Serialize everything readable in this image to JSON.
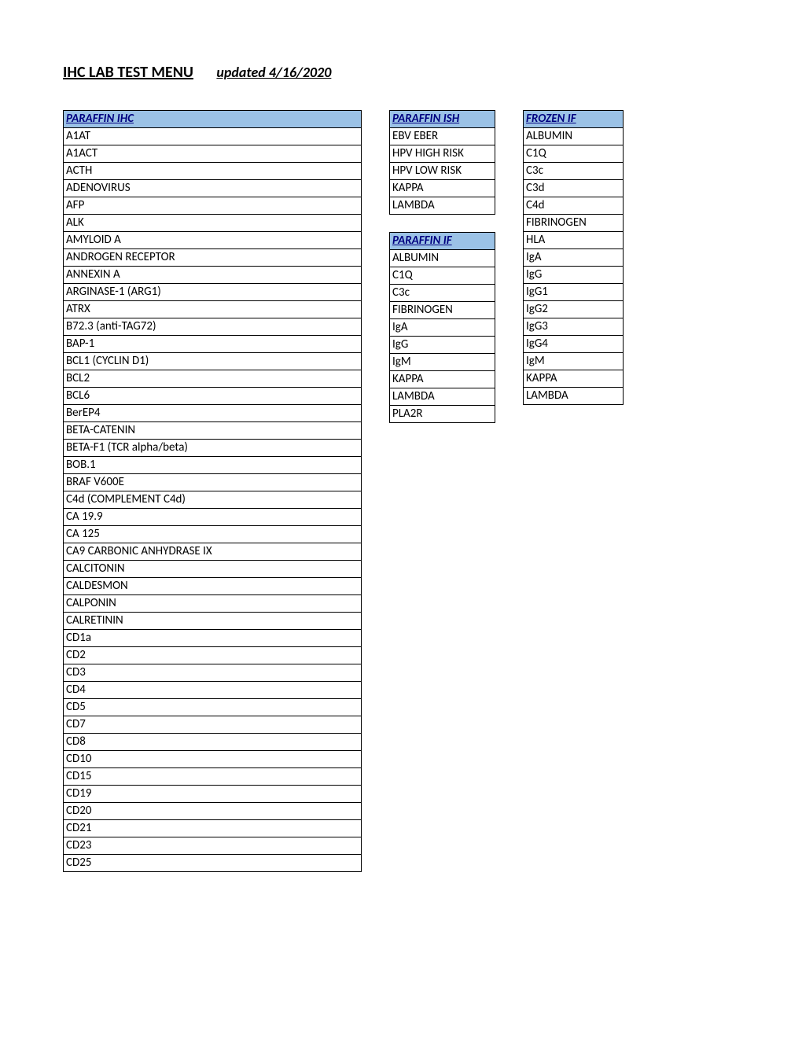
{
  "header": {
    "title": "IHC LAB TEST MENU",
    "updated": "updated 4/16/2020"
  },
  "tables": {
    "paraffin_ihc": {
      "header": "PARAFFIN IHC",
      "rows": [
        "A1AT",
        "A1ACT",
        "ACTH",
        "ADENOVIRUS",
        "AFP",
        "ALK",
        "AMYLOID A",
        "ANDROGEN RECEPTOR",
        "ANNEXIN A",
        "ARGINASE-1 (ARG1)",
        "ATRX",
        "B72.3 (anti-TAG72)",
        "BAP-1",
        "BCL1 (CYCLIN D1)",
        "BCL2",
        "BCL6",
        "BerEP4",
        "BETA-CATENIN",
        "BETA-F1 (TCR alpha/beta)",
        "BOB.1",
        "BRAF V600E",
        "C4d (COMPLEMENT C4d)",
        "CA 19.9",
        "CA 125",
        "CA9 CARBONIC ANHYDRASE IX",
        "CALCITONIN",
        "CALDESMON",
        "CALPONIN",
        "CALRETININ",
        "CD1a",
        "CD2",
        "CD3",
        "CD4",
        "CD5",
        "CD7",
        "CD8",
        "CD10",
        "CD15",
        "CD19",
        "CD20",
        "CD21",
        "CD23",
        "CD25"
      ]
    },
    "paraffin_ish": {
      "header": "PARAFFIN ISH",
      "rows": [
        "EBV EBER",
        "HPV HIGH RISK",
        "HPV LOW RISK",
        "KAPPA",
        "LAMBDA"
      ]
    },
    "paraffin_if": {
      "header": "PARAFFIN IF",
      "rows": [
        "ALBUMIN",
        "C1Q",
        "C3c",
        "FIBRINOGEN",
        "IgA",
        "IgG",
        "IgM",
        "KAPPA",
        "LAMBDA",
        "PLA2R"
      ]
    },
    "frozen_if": {
      "header": "FROZEN IF",
      "rows": [
        "ALBUMIN",
        "C1Q",
        "C3c",
        "C3d",
        "C4d",
        "FIBRINOGEN",
        "HLA",
        "IgA",
        "IgG",
        "IgG1",
        "IgG2",
        "IgG3",
        "IgG4",
        "IgM",
        "KAPPA",
        "LAMBDA"
      ]
    }
  }
}
